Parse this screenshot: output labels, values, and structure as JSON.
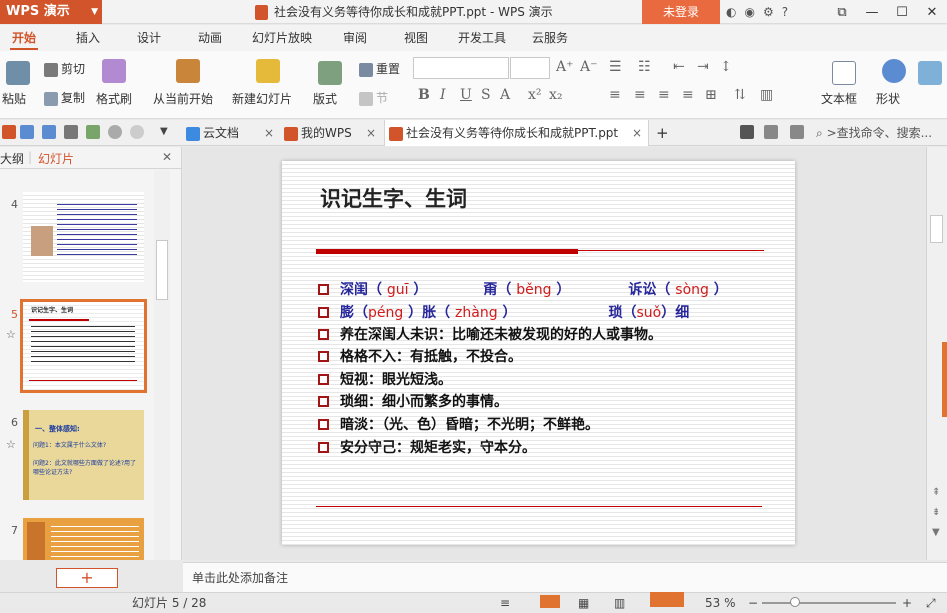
{
  "titlebar": {
    "app_button": "WPS 演示",
    "document_title": "社会没有义务等待你成长和成就PPT.ppt - WPS 演示",
    "login": "未登录",
    "help": "?"
  },
  "menu": [
    "开始",
    "插入",
    "设计",
    "动画",
    "幻灯片放映",
    "审阅",
    "视图",
    "开发工具",
    "云服务"
  ],
  "ribbon": {
    "paste": "粘贴",
    "cut": "剪切",
    "copy": "复制",
    "format_painter": "格式刷",
    "from_current": "从当前开始",
    "new_slide": "新建幻灯片",
    "layout": "版式",
    "reset": "重置",
    "section": "节",
    "textbox": "文本框",
    "shape": "形状"
  },
  "doc_tabs": [
    {
      "label": "云文档"
    },
    {
      "label": "我的WPS"
    },
    {
      "label": "社会没有义务等待你成长和成就PPT.ppt"
    }
  ],
  "search": {
    "placeholder": ">查找命令、搜索..."
  },
  "left_pane": {
    "tab_outline": "大纲",
    "tab_slides": "幻灯片",
    "thumb_numbers": [
      "4",
      "5",
      "6",
      "7"
    ],
    "thumb6_title": "一、整体感知:",
    "thumb6_q1": "问题1：本文属于什么文体?",
    "thumb6_q2": "问题2：此文就哪些方面做了论述?用了哪些论证方法?",
    "thumb5_title": "识记生字、生词",
    "add_button": "+"
  },
  "slide": {
    "title": "识记生字、生词",
    "row1": {
      "w1": "深闺",
      "p1": "guī",
      "w2": "甭",
      "p2": "běng",
      "w3": "诉讼",
      "p3": "sòng"
    },
    "row2": {
      "w1": "膨",
      "p1": "péng",
      "w2": "胀",
      "p2": "zhàng",
      "w3": "琐",
      "p3": "suǒ",
      "w4": "细"
    },
    "items": [
      "养在深闺人未识：比喻还未被发现的好的人或事物。",
      "格格不入：有抵触，不投合。",
      "短视：眼光短浅。",
      "琐细：细小而繁多的事情。",
      "暗淡：（光、色）昏暗；不光明；不鲜艳。",
      "安分守己：规矩老实，守本分。"
    ]
  },
  "notes_placeholder": "单击此处添加备注",
  "status": {
    "slide_counter": "幻灯片 5 / 28",
    "zoom": "53 %"
  },
  "colors": {
    "accent": "#d2542a",
    "slide_red": "#c00000",
    "slide_blue": "#27279b"
  }
}
